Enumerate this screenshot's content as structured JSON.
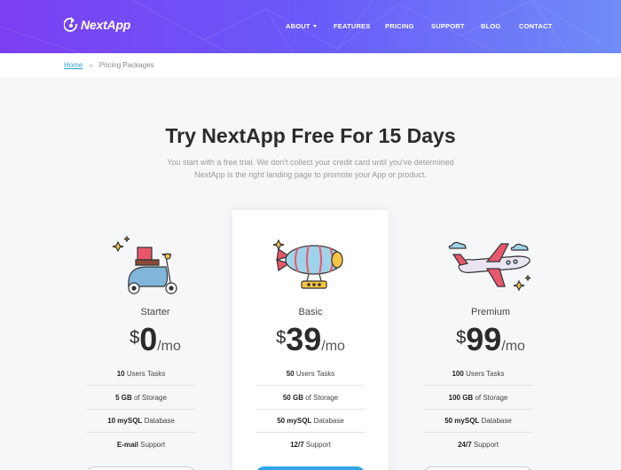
{
  "brand": {
    "name": "NextApp"
  },
  "nav": {
    "items": [
      "ABOUT",
      "FEATURES",
      "PRICING",
      "SUPPORT",
      "BLOG",
      "CONTACT"
    ]
  },
  "breadcrumb": {
    "home": "Home",
    "separator": "»",
    "current": "Pricing Packages"
  },
  "hero": {
    "title": "Try NextApp Free For 15 Days",
    "subtitle": "You start with a free trial. We don't collect your credit card until you've determined NextApp is the right landing page to promote your App or product."
  },
  "plans": [
    {
      "name": "Starter",
      "icon": "scooter-icon",
      "currency": "$",
      "amount": "0",
      "period": "/mo",
      "features": [
        {
          "value": "10",
          "label": "Users Tasks"
        },
        {
          "value": "5 GB",
          "label": "of Storage"
        },
        {
          "value": "10 mySQL",
          "label": "Database"
        },
        {
          "value": "E-mail",
          "label": "Support"
        }
      ]
    },
    {
      "name": "Basic",
      "icon": "airship-icon",
      "currency": "$",
      "amount": "39",
      "period": "/mo",
      "features": [
        {
          "value": "50",
          "label": "Users Tasks"
        },
        {
          "value": "50 GB",
          "label": "of Storage"
        },
        {
          "value": "50 mySQL",
          "label": "Database"
        },
        {
          "value": "12/7",
          "label": "Support"
        }
      ]
    },
    {
      "name": "Premium",
      "icon": "airplane-icon",
      "currency": "$",
      "amount": "99",
      "period": "/mo",
      "features": [
        {
          "value": "100",
          "label": "Users Tasks"
        },
        {
          "value": "100 GB",
          "label": "of Storage"
        },
        {
          "value": "50 mySQL",
          "label": "Database"
        },
        {
          "value": "24/7",
          "label": "Support"
        }
      ]
    }
  ],
  "colors": {
    "header_start": "#7b3ff2",
    "header_end": "#6f8cf7",
    "accent": "#2fa6e8",
    "link": "#2a9fd8"
  }
}
